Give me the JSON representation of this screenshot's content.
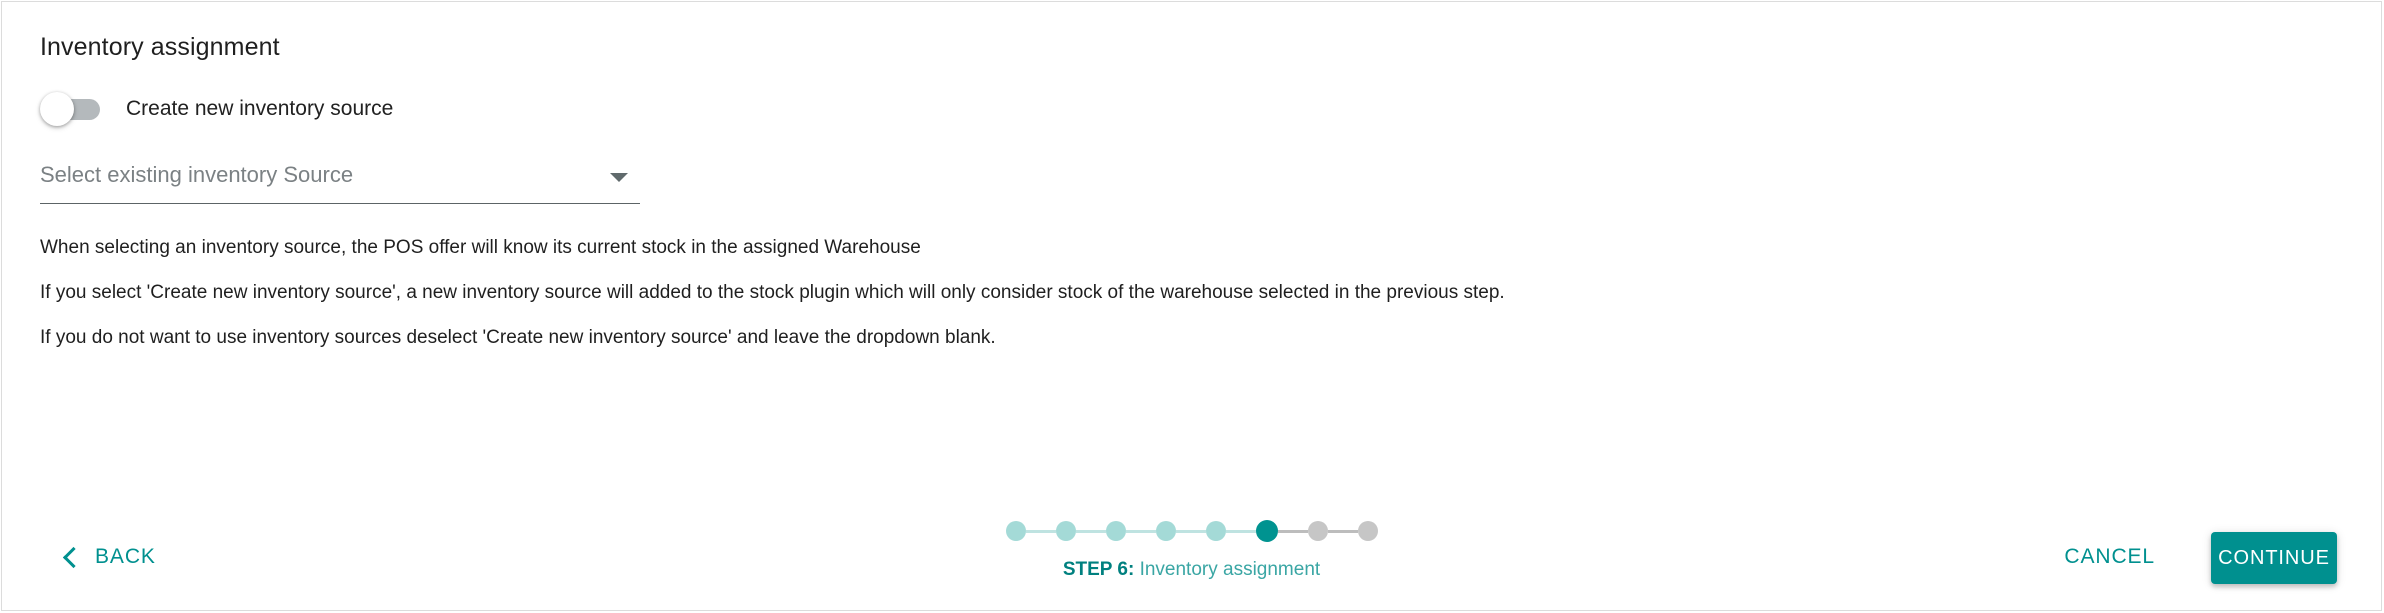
{
  "card": {
    "section_title": "Inventory assignment"
  },
  "toggle": {
    "label": "Create new inventory source",
    "state": "off"
  },
  "select": {
    "value": "Select existing inventory Source",
    "placeholder": "Select existing inventory Source",
    "arrow_icon": "chevron-down-icon"
  },
  "help": {
    "line_1": "When selecting an inventory source, the POS offer will know its current stock in the assigned Warehouse",
    "line_2": "If you select 'Create new inventory source', a new inventory source will added to the stock plugin which will only consider stock of the warehouse selected in the previous step.",
    "line_3": "If you do not want to use inventory sources deselect 'Create new inventory source' and leave the dropdown blank."
  },
  "footer": {
    "back_label": "BACK",
    "back_icon": "chevron-left-icon",
    "cancel_label": "CANCEL",
    "continue_label": "CONTINUE"
  },
  "stepper": {
    "total_steps": 8,
    "current_step": 6,
    "step_prefix": "STEP 6:",
    "step_name": " Inventory assignment",
    "dots": [
      {
        "state": "done"
      },
      {
        "state": "done"
      },
      {
        "state": "done"
      },
      {
        "state": "done"
      },
      {
        "state": "done"
      },
      {
        "state": "current"
      },
      {
        "state": "todo"
      },
      {
        "state": "todo"
      }
    ]
  },
  "colors": {
    "accent": "#00908f",
    "accent_light": "#a4dad7",
    "accent_caption": "#3aa6a4",
    "inactive": "#c6c6c6",
    "text": "#1f1f1f",
    "muted": "#7b8184",
    "card_border": "#dcdcdc"
  }
}
